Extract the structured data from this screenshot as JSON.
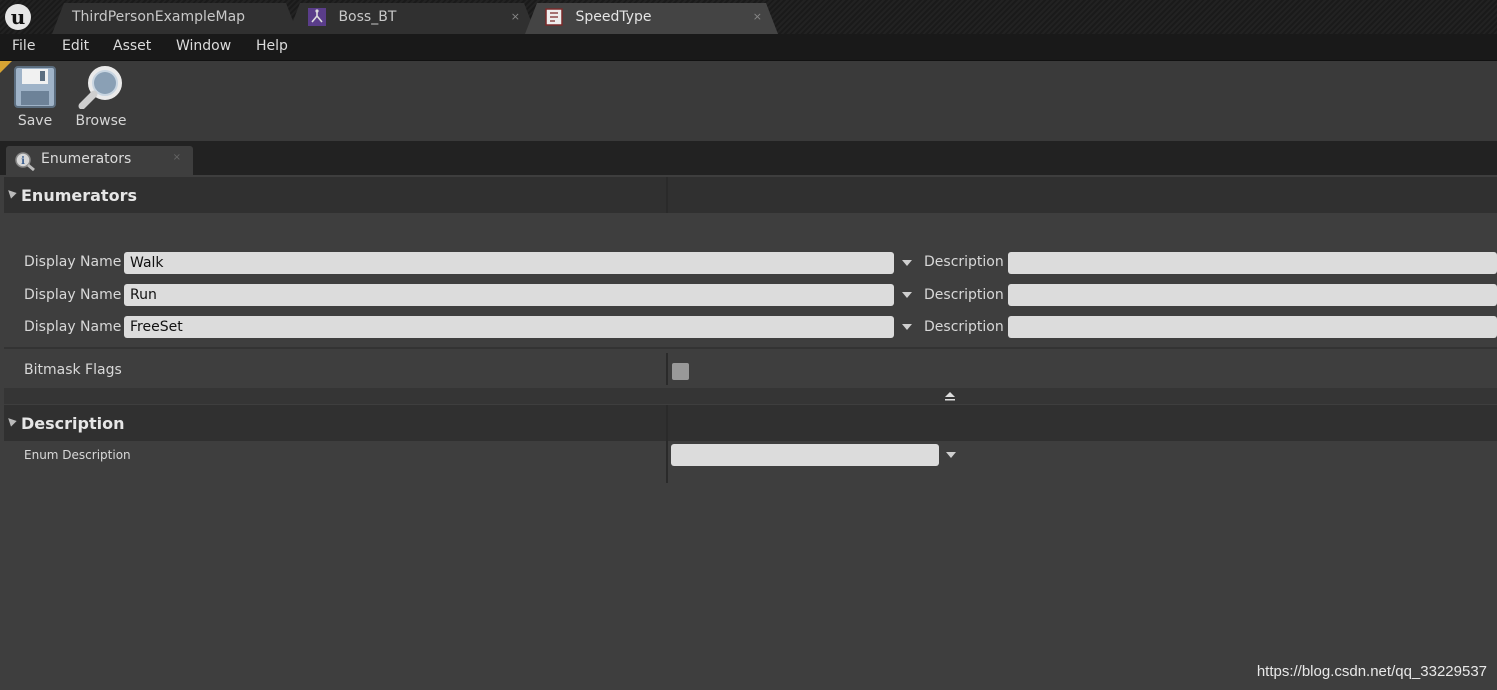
{
  "tabs": [
    {
      "label": "ThirdPersonExampleMap",
      "icon": "map-icon"
    },
    {
      "label": "Boss_BT",
      "icon": "behavior-tree-icon",
      "close": "×"
    },
    {
      "label": "SpeedType",
      "icon": "enum-asset-icon",
      "close": "×"
    }
  ],
  "menu": [
    "File",
    "Edit",
    "Asset",
    "Window",
    "Help"
  ],
  "toolbar": {
    "save_label": "Save",
    "browse_label": "Browse"
  },
  "panel_tab": {
    "label": "Enumerators",
    "close": "×"
  },
  "enumerators": {
    "header": "Enumerators",
    "display_name_label": "Display Name",
    "description_label": "Description",
    "items": [
      {
        "display_name": "Walk",
        "description": ""
      },
      {
        "display_name": "Run",
        "description": ""
      },
      {
        "display_name": "FreeSet",
        "description": ""
      }
    ],
    "bitmask_label": "Bitmask Flags",
    "bitmask_checked": false
  },
  "description_section": {
    "header": "Description",
    "enum_description_label": "Enum Description",
    "enum_description_value": ""
  },
  "watermark": "https://blog.csdn.net/qq_33229537",
  "colors": {
    "accent": "#d7a433",
    "background": "#3e3e3e",
    "field": "#dcdcdc"
  }
}
